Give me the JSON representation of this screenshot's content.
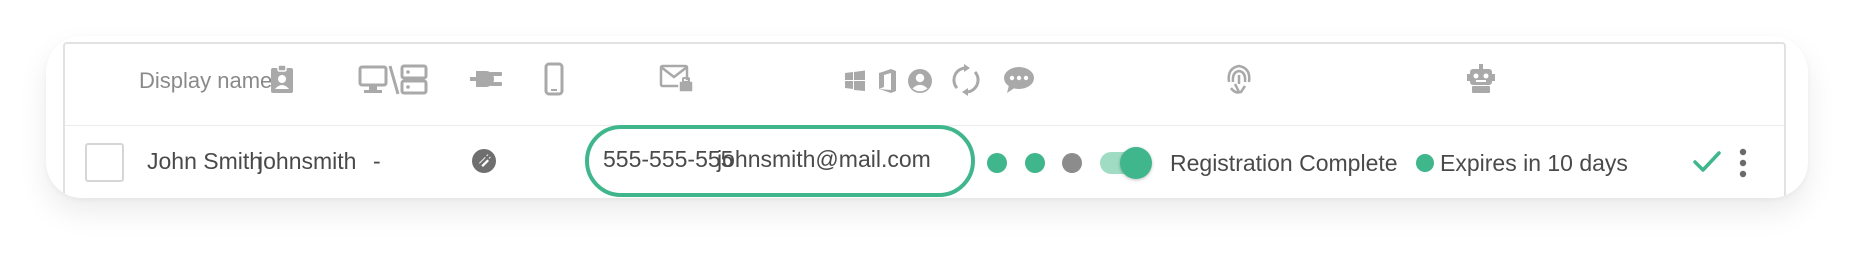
{
  "header": {
    "display_name_label": "Display name",
    "columns": [
      {
        "icon": "contact-badge-icon"
      },
      {
        "icon": "device-server-icon"
      },
      {
        "icon": "plug-icon"
      },
      {
        "icon": "mobile-phone-icon"
      },
      {
        "icon": "mail-briefcase-icon"
      },
      {
        "icon": "windows-icon"
      },
      {
        "icon": "office-icon"
      },
      {
        "icon": "user-circle-icon"
      },
      {
        "icon": "sync-icon"
      },
      {
        "icon": "chat-icon"
      },
      {
        "icon": "biometric-icon"
      },
      {
        "icon": "robot-icon"
      }
    ]
  },
  "row": {
    "display_name": "John Smith",
    "username": "johnsmith",
    "device": "-",
    "phone": "555-555-555",
    "email": "johnsmith@mail.com",
    "status_dots": [
      {
        "name": "windows-status",
        "color": "#3fb68b"
      },
      {
        "name": "office-status",
        "color": "#3fb68b"
      },
      {
        "name": "user-status",
        "color": "#8c8c8c"
      }
    ],
    "toggle_on": true,
    "registration_status": "Registration Complete",
    "expiry_dot_color": "#3fb68b",
    "expiry_text": "Expires in 10 days"
  },
  "colors": {
    "accent": "#3fb68b",
    "icon_gray": "#a9a9a9",
    "text": "#4a4a4a"
  }
}
